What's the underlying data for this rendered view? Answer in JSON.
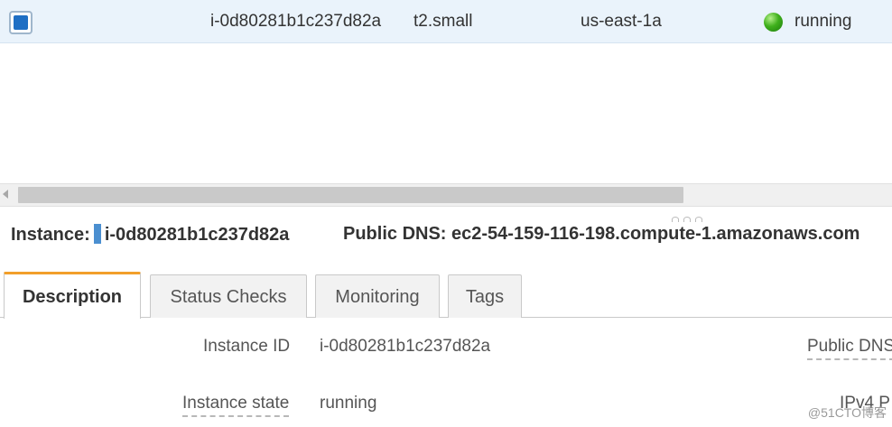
{
  "instance_row": {
    "instance_id": "i-0d80281b1c237d82a",
    "instance_type": "t2.small",
    "availability_zone": "us-east-1a",
    "state": "running",
    "state_color": "#3fb01c"
  },
  "detail_header": {
    "instance_label": "Instance:",
    "instance_id": "i-0d80281b1c237d82a",
    "public_dns_label": "Public DNS:",
    "public_dns_value": "ec2-54-159-116-198.compute-1.amazonaws.com"
  },
  "tabs": [
    {
      "label": "Description",
      "active": true
    },
    {
      "label": "Status Checks",
      "active": false
    },
    {
      "label": "Monitoring",
      "active": false
    },
    {
      "label": "Tags",
      "active": false
    }
  ],
  "description": {
    "instance_id_label": "Instance ID",
    "instance_id_value": "i-0d80281b1c237d82a",
    "instance_state_label": "Instance state",
    "instance_state_value": "running",
    "public_dns_label": "Public DNS",
    "ipv4_label": "IPv4 P"
  },
  "watermark": "@51CTO博客",
  "accent_color": "#f29f2a"
}
